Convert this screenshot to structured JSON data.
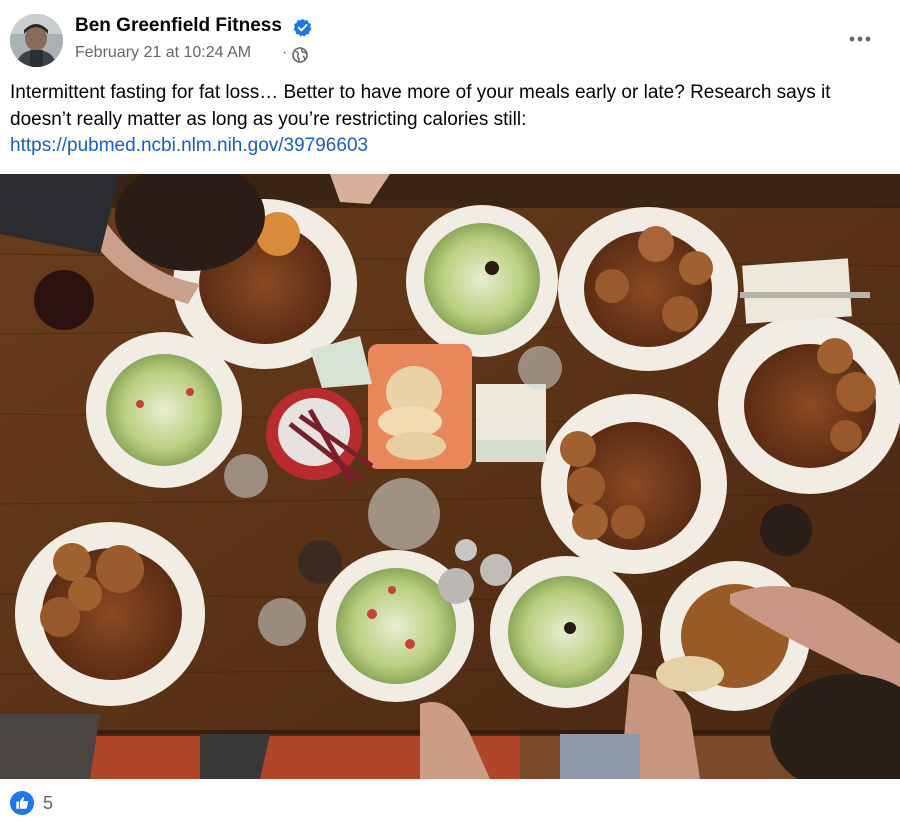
{
  "author": {
    "name": "Ben Greenfield Fitness",
    "verified_icon": "verified-badge-icon",
    "avatar_icon": "profile-avatar"
  },
  "post": {
    "timestamp": "February 21 at 10:24 AM",
    "separator": "·",
    "audience_icon": "globe-icon",
    "text": "Intermittent fasting for fat loss… Better to have more of your meals early or late? Research says it doesn’t really matter as long as you’re restricting calories still:",
    "link": "https://pubmed.ncbi.nlm.nih.gov/39796603",
    "image_icon": "food-table-photo"
  },
  "menu": {
    "icon": "more-options-icon"
  },
  "reactions": {
    "icon": "like-reaction-icon",
    "count": "5"
  },
  "colors": {
    "text": "#050505",
    "secondary": "#65676b",
    "link": "#1a5ec8",
    "brand_blue": "#1877f2"
  }
}
